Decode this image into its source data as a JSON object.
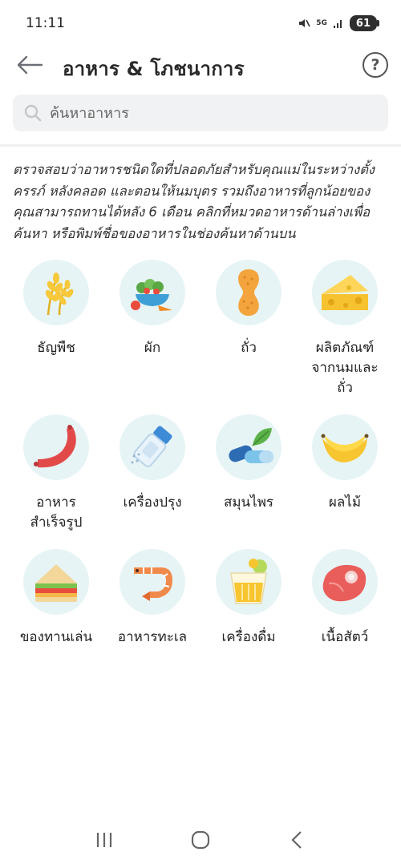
{
  "status_bar": {
    "time": "11:11",
    "network": "5G",
    "battery": "61"
  },
  "header": {
    "title": "อาหาร & โภชนาการ",
    "help_label": "?"
  },
  "search": {
    "placeholder": "ค้นหาอาหาร"
  },
  "description": "ตรวจสอบว่าอาหารชนิดใดที่ปลอดภัยสำหรับคุณแม่ในระหว่างตั้งครรภ์ หลังคลอด และตอนให้นมบุตร รวมถึงอาหารที่ลูกน้อยของคุณสามารถทานได้หลัง 6 เดือน คลิกที่หมวดอาหารด้านล่างเพื่อค้นหา หรือพิมพ์ชื่อของอาหารในช่องค้นหาด้านบน",
  "categories": [
    {
      "label": "ธัญพืช",
      "icon": "wheat-icon"
    },
    {
      "label": "ผัก",
      "icon": "vegetable-bowl-icon"
    },
    {
      "label": "ถั่ว",
      "icon": "peanut-icon"
    },
    {
      "label": "ผลิตภัณฑ์\nจากนมและ\nถั่ว",
      "icon": "cheese-icon"
    },
    {
      "label": "อาหาร\nสำเร็จรูป",
      "icon": "sausage-icon"
    },
    {
      "label": "เครื่องปรุง",
      "icon": "salt-shaker-icon"
    },
    {
      "label": "สมุนไพร",
      "icon": "herb-capsule-icon"
    },
    {
      "label": "ผลไม้",
      "icon": "banana-icon"
    },
    {
      "label": "ของทานเล่น",
      "icon": "sandwich-icon"
    },
    {
      "label": "อาหารทะเล",
      "icon": "shrimp-icon"
    },
    {
      "label": "เครื่องดื่ม",
      "icon": "drink-glass-icon"
    },
    {
      "label": "เนื้อสัตว์",
      "icon": "steak-icon"
    }
  ],
  "colors": {
    "circle_bg": "#e7f4f6",
    "search_bg": "#f1f2f3"
  }
}
